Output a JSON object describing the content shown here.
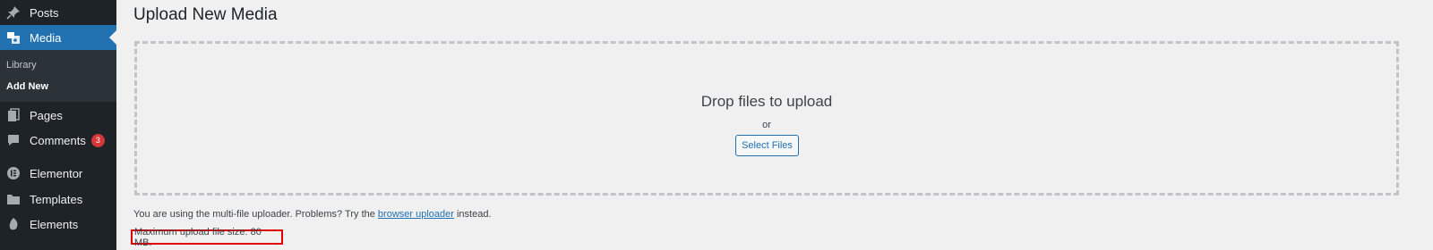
{
  "sidebar": {
    "items": [
      {
        "label": "Posts",
        "icon": "pushpin-icon"
      },
      {
        "label": "Media",
        "icon": "media-icon",
        "current": true
      },
      {
        "label": "Pages",
        "icon": "pages-icon"
      },
      {
        "label": "Comments",
        "icon": "comment-icon",
        "badge": "3"
      },
      {
        "label": "Elementor",
        "icon": "elementor-icon"
      },
      {
        "label": "Templates",
        "icon": "folder-icon"
      },
      {
        "label": "Elements",
        "icon": "elements-icon"
      }
    ],
    "submenu": [
      {
        "label": "Library"
      },
      {
        "label": "Add New",
        "active": true
      }
    ]
  },
  "main": {
    "title": "Upload New Media",
    "drop_title": "Drop files to upload",
    "drop_or": "or",
    "select_button": "Select Files",
    "info_prefix": "You are using the multi-file uploader. Problems? Try the",
    "info_link": "browser uploader",
    "info_suffix": "instead.",
    "max_size": "Maximum upload file size: 80 MB."
  },
  "colors": {
    "sidebar_bg": "#1d2327",
    "accent": "#2271b1",
    "badge": "#d63638",
    "highlight_border": "#e00000"
  }
}
